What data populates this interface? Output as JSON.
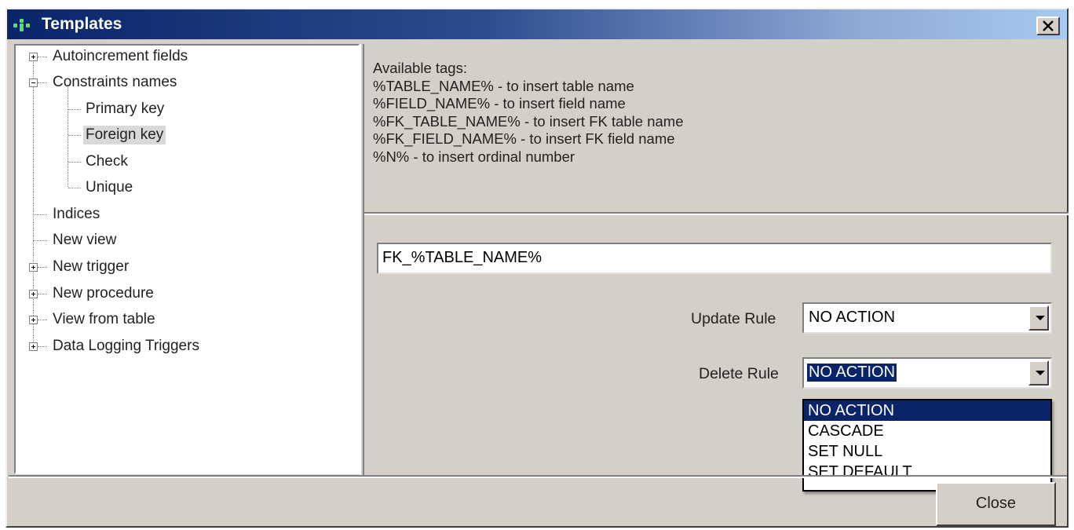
{
  "window": {
    "title": "Templates",
    "close_glyph": "×"
  },
  "tree": {
    "items": [
      {
        "label": "Autoincrement fields",
        "expander": "plus"
      },
      {
        "label": "Constraints names",
        "expander": "minus"
      },
      {
        "label": "Primary key"
      },
      {
        "label": "Foreign key",
        "selected": true
      },
      {
        "label": "Check"
      },
      {
        "label": "Unique"
      },
      {
        "label": "Indices"
      },
      {
        "label": "New view"
      },
      {
        "label": "New trigger",
        "expander": "plus"
      },
      {
        "label": "New procedure",
        "expander": "plus"
      },
      {
        "label": "View from table",
        "expander": "plus"
      },
      {
        "label": "Data Logging Triggers",
        "expander": "plus"
      }
    ]
  },
  "tags": {
    "heading": "Available tags:",
    "lines": [
      "%TABLE_NAME% - to insert table name",
      "%FIELD_NAME% - to insert field name",
      "%FK_TABLE_NAME% - to insert FK table name",
      "%FK_FIELD_NAME% - to insert FK field name",
      "%N% - to insert ordinal number"
    ]
  },
  "template_input": {
    "value": "FK_%TABLE_NAME%"
  },
  "update_rule": {
    "label": "Update Rule",
    "value": "NO ACTION"
  },
  "delete_rule": {
    "label": "Delete Rule",
    "value": "NO ACTION",
    "options": [
      "NO ACTION",
      "CASCADE",
      "SET NULL",
      "SET DEFAULT"
    ]
  },
  "buttons": {
    "close_label": "Close"
  },
  "colors": {
    "title_gradient_start": "#0a246a",
    "title_gradient_end": "#a6caf0",
    "selection_highlight": "#0a246a",
    "face": "#d4d0c8"
  }
}
